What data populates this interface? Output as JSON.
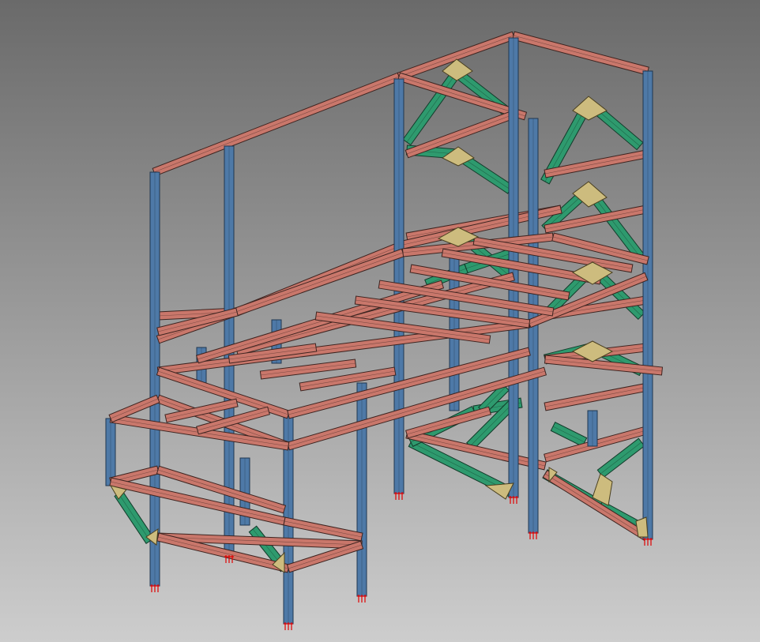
{
  "viewport": {
    "background": {
      "top": "#6a6a6a",
      "bottom": "#cdcdcd"
    }
  },
  "colors": {
    "column": "#4e79a7",
    "column_edge": "#1f3650",
    "beam": "#c9776b",
    "beam_edge": "#3d2420",
    "brace": "#2e9a6e",
    "brace_edge": "#123b2a",
    "gusset": "#cdbc7e",
    "gusset_edge": "#4a4020",
    "anchor": "#e00000"
  }
}
